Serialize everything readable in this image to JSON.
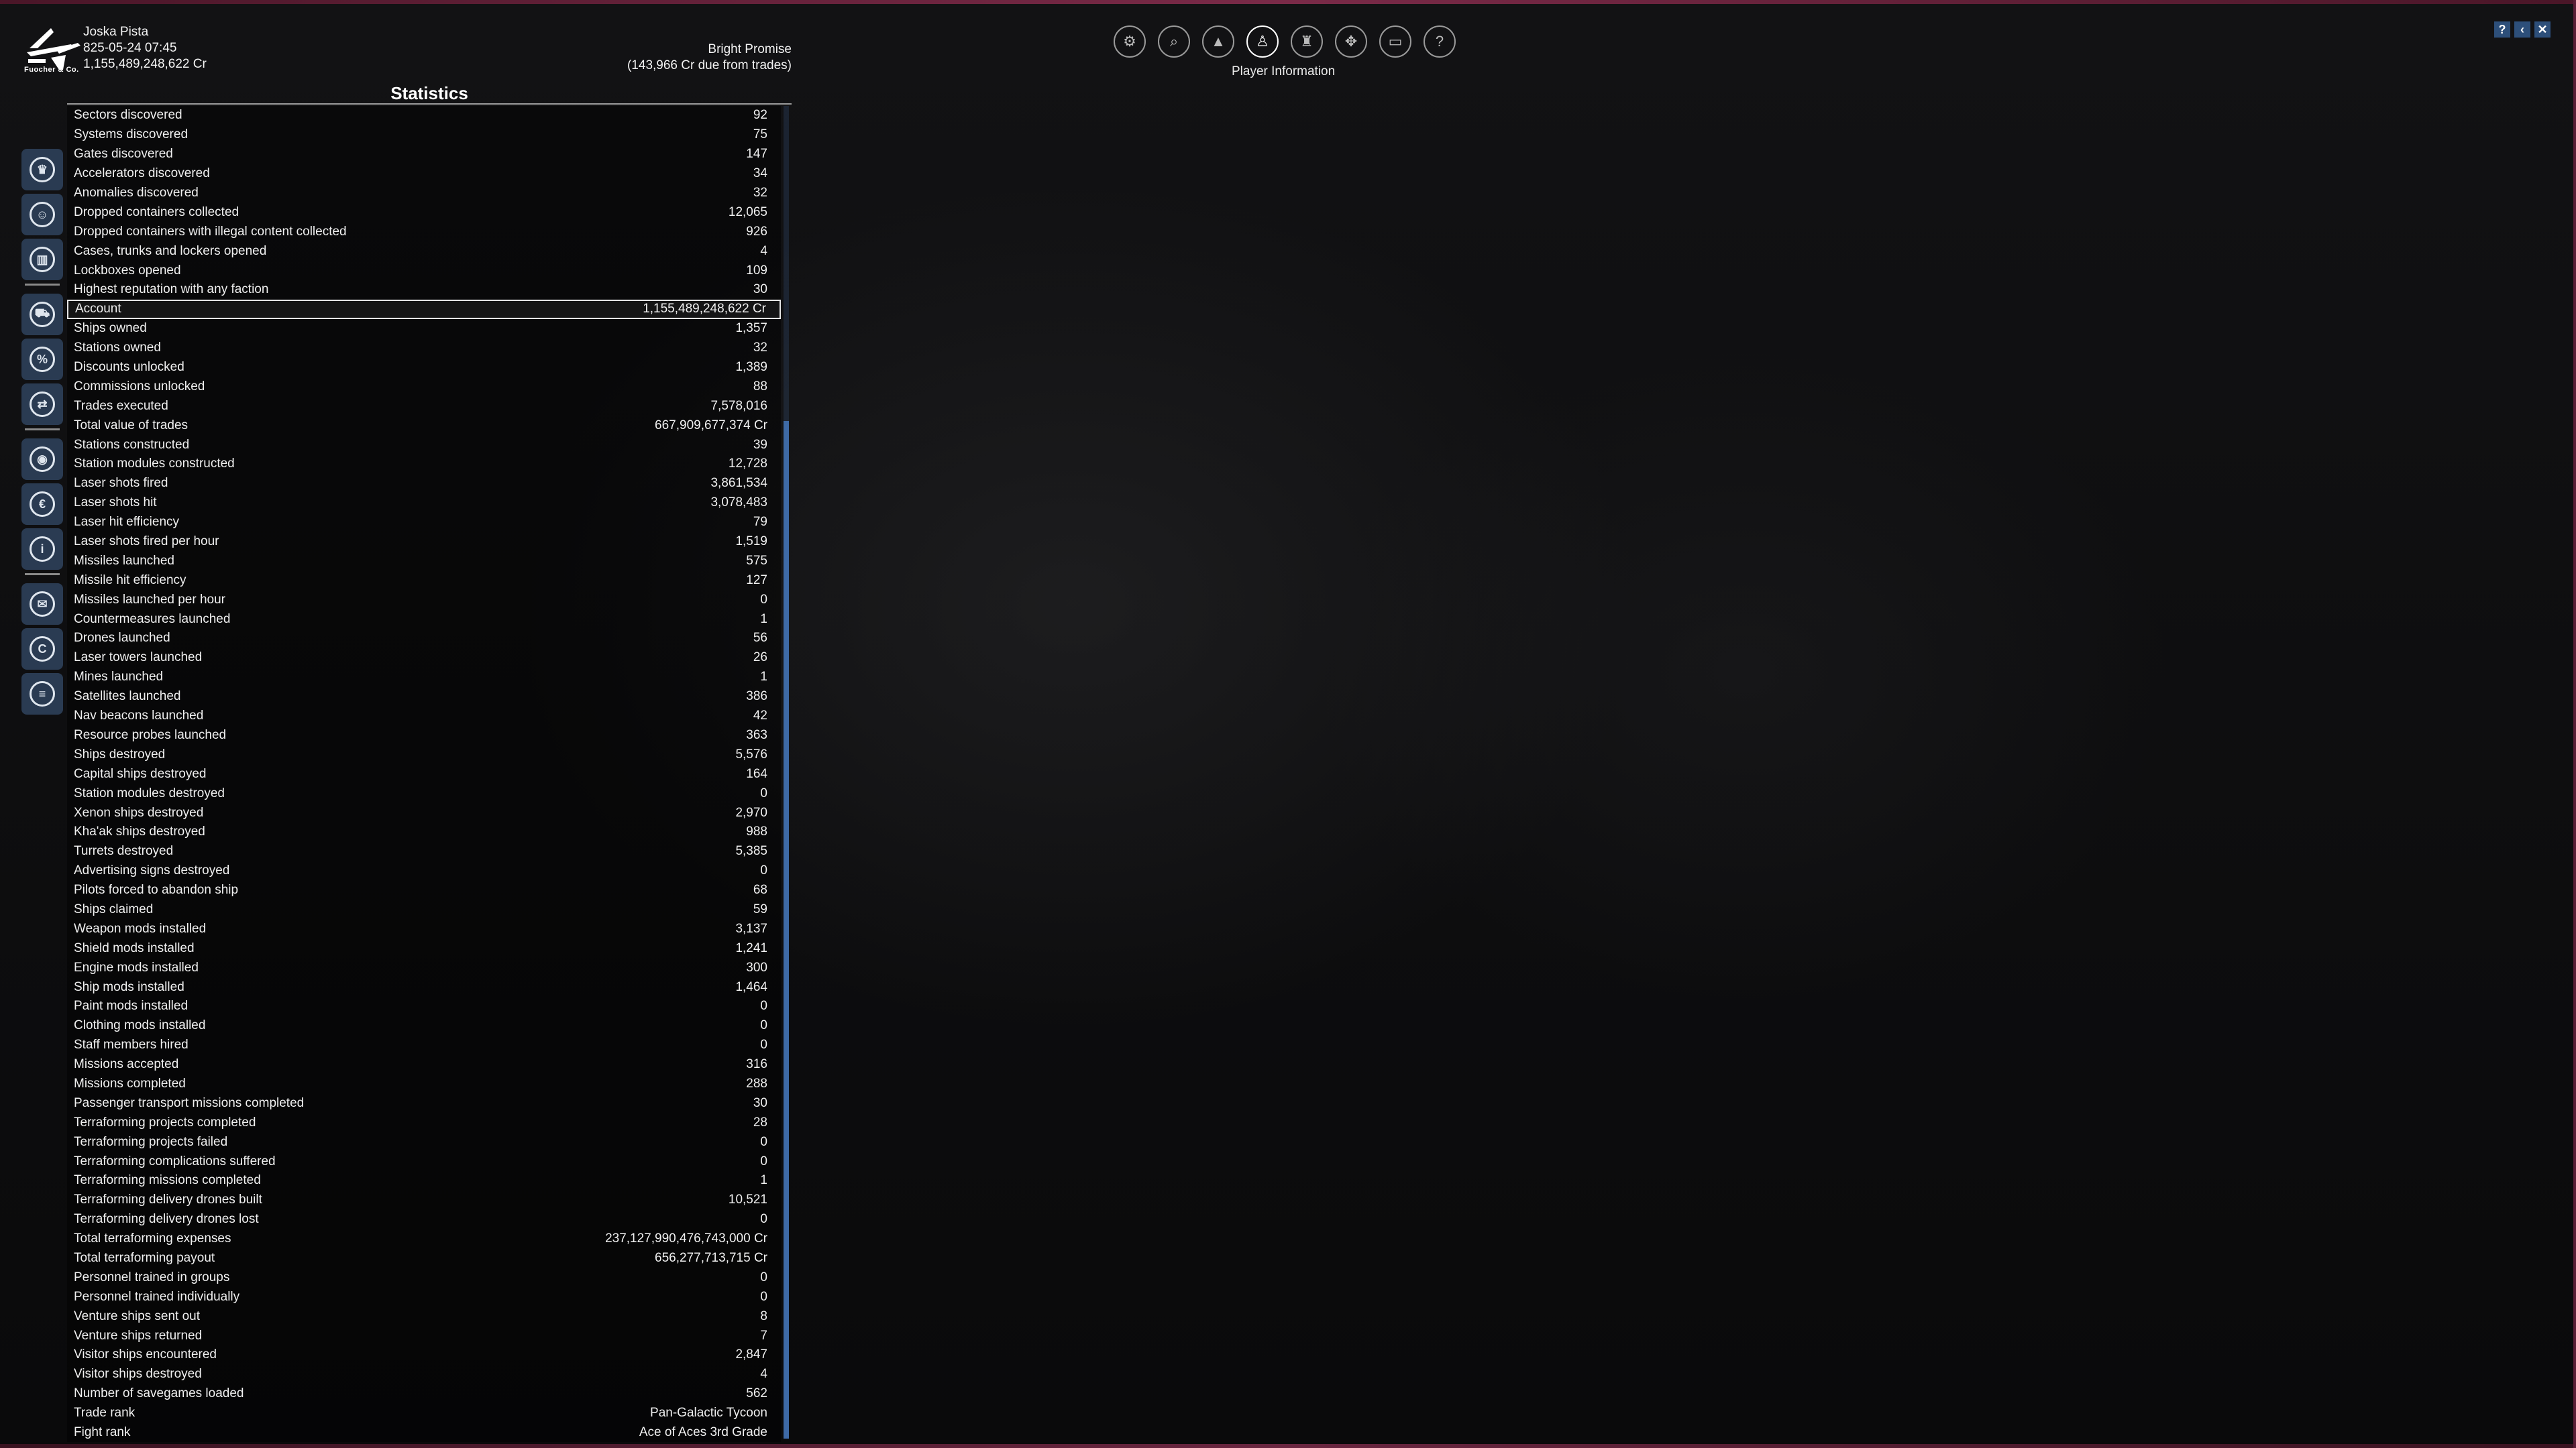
{
  "header": {
    "logo_text": "Fuocher & Co.",
    "player_name": "Joska Pista",
    "datetime": "825-05-24 07:45",
    "credits": "1,155,489,248,622 Cr",
    "ship_name": "Bright Promise",
    "trade_due": "(143,966 Cr due from trades)"
  },
  "nav": {
    "active_label": "Player Information",
    "buttons": [
      "settings-icon",
      "search-icon",
      "empire-icon",
      "player-info-icon",
      "pilot-icon",
      "map-icon",
      "ship-icon",
      "help-icon"
    ]
  },
  "window_controls": {
    "help": "?",
    "back": "‹",
    "close": "✕"
  },
  "panel": {
    "title": "Statistics"
  },
  "sidebar_icons": [
    "crown-icon",
    "people-icon",
    "chart-icon",
    "ship-box-icon",
    "percent-icon",
    "trade-icon",
    "station-icon",
    "credit-icon",
    "info-icon",
    "mail-icon",
    "copyright-icon",
    "hangar-icon"
  ],
  "stats": [
    {
      "label": "Sectors discovered",
      "value": "92"
    },
    {
      "label": "Systems discovered",
      "value": "75"
    },
    {
      "label": "Gates discovered",
      "value": "147"
    },
    {
      "label": "Accelerators discovered",
      "value": "34"
    },
    {
      "label": "Anomalies discovered",
      "value": "32"
    },
    {
      "label": "Dropped containers collected",
      "value": "12,065"
    },
    {
      "label": "Dropped containers with illegal content collected",
      "value": "926"
    },
    {
      "label": "Cases, trunks and lockers opened",
      "value": "4"
    },
    {
      "label": "Lockboxes opened",
      "value": "109"
    },
    {
      "label": "Highest reputation with any faction",
      "value": "30"
    },
    {
      "label": "Account",
      "value": "1,155,489,248,622 Cr"
    },
    {
      "label": "Ships owned",
      "value": "1,357"
    },
    {
      "label": "Stations owned",
      "value": "32"
    },
    {
      "label": "Discounts unlocked",
      "value": "1,389"
    },
    {
      "label": "Commissions unlocked",
      "value": "88"
    },
    {
      "label": "Trades executed",
      "value": "7,578,016"
    },
    {
      "label": "Total value of trades",
      "value": "667,909,677,374 Cr"
    },
    {
      "label": "Stations constructed",
      "value": "39"
    },
    {
      "label": "Station modules constructed",
      "value": "12,728"
    },
    {
      "label": "Laser shots fired",
      "value": "3,861,534"
    },
    {
      "label": "Laser shots hit",
      "value": "3,078,483"
    },
    {
      "label": "Laser hit efficiency",
      "value": "79"
    },
    {
      "label": "Laser shots fired per hour",
      "value": "1,519"
    },
    {
      "label": "Missiles launched",
      "value": "575"
    },
    {
      "label": "Missile hit efficiency",
      "value": "127"
    },
    {
      "label": "Missiles launched per hour",
      "value": "0"
    },
    {
      "label": "Countermeasures launched",
      "value": "1"
    },
    {
      "label": "Drones launched",
      "value": "56"
    },
    {
      "label": "Laser towers launched",
      "value": "26"
    },
    {
      "label": "Mines launched",
      "value": "1"
    },
    {
      "label": "Satellites launched",
      "value": "386"
    },
    {
      "label": "Nav beacons launched",
      "value": "42"
    },
    {
      "label": "Resource probes launched",
      "value": "363"
    },
    {
      "label": "Ships destroyed",
      "value": "5,576"
    },
    {
      "label": "Capital ships destroyed",
      "value": "164"
    },
    {
      "label": "Station modules destroyed",
      "value": "0"
    },
    {
      "label": "Xenon ships destroyed",
      "value": "2,970"
    },
    {
      "label": "Kha'ak ships destroyed",
      "value": "988"
    },
    {
      "label": "Turrets destroyed",
      "value": "5,385"
    },
    {
      "label": "Advertising signs destroyed",
      "value": "0"
    },
    {
      "label": "Pilots forced to abandon ship",
      "value": "68"
    },
    {
      "label": "Ships claimed",
      "value": "59"
    },
    {
      "label": "Weapon mods installed",
      "value": "3,137"
    },
    {
      "label": "Shield mods installed",
      "value": "1,241"
    },
    {
      "label": "Engine mods installed",
      "value": "300"
    },
    {
      "label": "Ship mods installed",
      "value": "1,464"
    },
    {
      "label": "Paint mods installed",
      "value": "0"
    },
    {
      "label": "Clothing mods installed",
      "value": "0"
    },
    {
      "label": "Staff members hired",
      "value": "0"
    },
    {
      "label": "Missions accepted",
      "value": "316"
    },
    {
      "label": "Missions completed",
      "value": "288"
    },
    {
      "label": "Passenger transport missions completed",
      "value": "30"
    },
    {
      "label": "Terraforming projects completed",
      "value": "28"
    },
    {
      "label": "Terraforming projects failed",
      "value": "0"
    },
    {
      "label": "Terraforming complications suffered",
      "value": "0"
    },
    {
      "label": "Terraforming missions completed",
      "value": "1"
    },
    {
      "label": "Terraforming delivery drones built",
      "value": "10,521"
    },
    {
      "label": "Terraforming delivery drones lost",
      "value": "0"
    },
    {
      "label": "Total terraforming expenses",
      "value": "237,127,990,476,743,000 Cr"
    },
    {
      "label": "Total terraforming payout",
      "value": "656,277,713,715 Cr"
    },
    {
      "label": "Personnel trained in groups",
      "value": "0"
    },
    {
      "label": "Personnel trained individually",
      "value": "0"
    },
    {
      "label": "Venture ships sent out",
      "value": "8"
    },
    {
      "label": "Venture ships returned",
      "value": "7"
    },
    {
      "label": "Visitor ships encountered",
      "value": "2,847"
    },
    {
      "label": "Visitor ships destroyed",
      "value": "4"
    },
    {
      "label": "Number of savegames loaded",
      "value": "562"
    },
    {
      "label": "Trade rank",
      "value": "Pan-Galactic Tycoon"
    },
    {
      "label": "Fight rank",
      "value": "Ace of Aces 3rd Grade"
    }
  ],
  "highlighted_row": 10
}
